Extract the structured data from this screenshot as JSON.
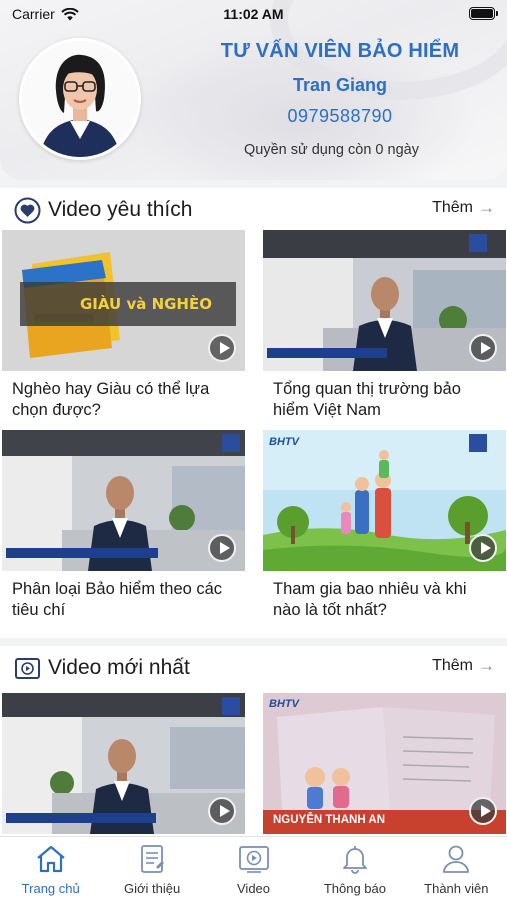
{
  "status_bar": {
    "carrier": "Carrier",
    "time": "11:02 AM"
  },
  "profile": {
    "title": "TƯ VẤN VIÊN BẢO HIỂM",
    "name": "Tran Giang",
    "phone": "0979588790",
    "quota": "Quyền sử dụng còn 0 ngày"
  },
  "favorites": {
    "title": "Video yêu thích",
    "more": "Thêm",
    "videos": [
      {
        "title": "Nghèo hay Giàu có thể lựa chọn được?",
        "overlay": "GIÀU và NGHÈO"
      },
      {
        "title": "Tổng quan thị trường bảo hiểm Việt Nam"
      },
      {
        "title": "Phân loại Bảo hiểm theo các tiêu chí"
      },
      {
        "title": "Tham gia bao nhiêu và khi nào là tốt nhất?",
        "brand": "BHTV"
      }
    ]
  },
  "latest": {
    "title": "Video mới nhất",
    "more": "Thêm",
    "videos": [
      {
        "title": ""
      },
      {
        "title": "",
        "brand": "BHTV",
        "caption": "NGUYỄN THANH AN"
      }
    ]
  },
  "tabs": [
    {
      "label": "Trang chủ",
      "icon": "home-icon",
      "active": true
    },
    {
      "label": "Giới thiệu",
      "icon": "document-icon",
      "active": false
    },
    {
      "label": "Video",
      "icon": "video-icon",
      "active": false
    },
    {
      "label": "Thông báo",
      "icon": "bell-icon",
      "active": false
    },
    {
      "label": "Thành viên",
      "icon": "user-icon",
      "active": false
    }
  ],
  "colors": {
    "accent": "#2d6fc1",
    "tab_inactive": "#7a8fb0"
  }
}
